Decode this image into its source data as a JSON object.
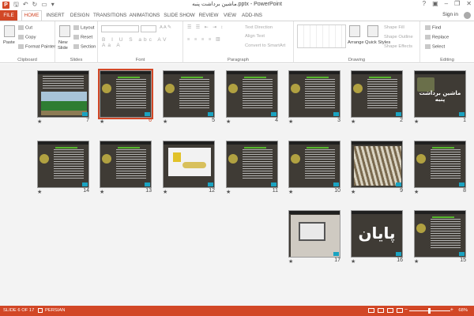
{
  "window": {
    "title": "ماشین برداشت پنبه.pptx - PowerPoint",
    "controls": [
      "?",
      "▣",
      "–",
      "❐",
      "✕"
    ]
  },
  "tabs": [
    "FILE",
    "HOME",
    "INSERT",
    "DESIGN",
    "TRANSITIONS",
    "ANIMATIONS",
    "SLIDE SHOW",
    "REVIEW",
    "VIEW",
    "ADD-INS"
  ],
  "account": {
    "sign_in": "Sign in"
  },
  "ribbon": {
    "clipboard": {
      "label": "Clipboard",
      "paste": "Paste",
      "cut": "Cut",
      "copy": "Copy",
      "format_painter": "Format Painter"
    },
    "slides": {
      "label": "Slides",
      "new_slide": "New",
      "new_slide2": "Slide",
      "layout": "Layout",
      "reset": "Reset",
      "section": "Section"
    },
    "font": {
      "label": "Font",
      "format_buttons": "B I U S abc AV Aa A"
    },
    "paragraph": {
      "label": "Paragraph",
      "text_direction": "Text Direction",
      "align_text": "Align Text",
      "convert_smartart": "Convert to SmartArt"
    },
    "drawing": {
      "label": "Drawing",
      "arrange": "Arrange",
      "quick_styles": "Quick Styles",
      "shape_fill": "Shape Fill",
      "shape_outline": "Shape Outline",
      "shape_effects": "Shape Effects"
    },
    "editing": {
      "label": "Editing",
      "find": "Find",
      "replace": "Replace",
      "select": "Select"
    }
  },
  "slides": [
    {
      "num": "1",
      "kind": "title",
      "title": "ماشین برداشت پنبه"
    },
    {
      "num": "2",
      "kind": "text"
    },
    {
      "num": "3",
      "kind": "text"
    },
    {
      "num": "4",
      "kind": "text"
    },
    {
      "num": "5",
      "kind": "text"
    },
    {
      "num": "6",
      "kind": "text",
      "selected": true
    },
    {
      "num": "7",
      "kind": "tractor"
    },
    {
      "num": "8",
      "kind": "text"
    },
    {
      "num": "9",
      "kind": "cotton"
    },
    {
      "num": "10",
      "kind": "text"
    },
    {
      "num": "11",
      "kind": "text"
    },
    {
      "num": "12",
      "kind": "machine"
    },
    {
      "num": "13",
      "kind": "text"
    },
    {
      "num": "14",
      "kind": "text"
    },
    {
      "num": "15",
      "kind": "text"
    },
    {
      "num": "16",
      "kind": "end",
      "title": "پایان"
    },
    {
      "num": "17",
      "kind": "laptop"
    }
  ],
  "star": "★",
  "statusbar": {
    "slide_info": "SLIDE 6 OF 17",
    "language": "PERSIAN",
    "zoom_minus": "−",
    "zoom_plus": "+",
    "zoom": "68%"
  },
  "colors": {
    "accent": "#d24726",
    "thumb_bg": "#3f3b35",
    "highlight_green": "#55b52c",
    "corner_teal": "#1aa3c1"
  }
}
